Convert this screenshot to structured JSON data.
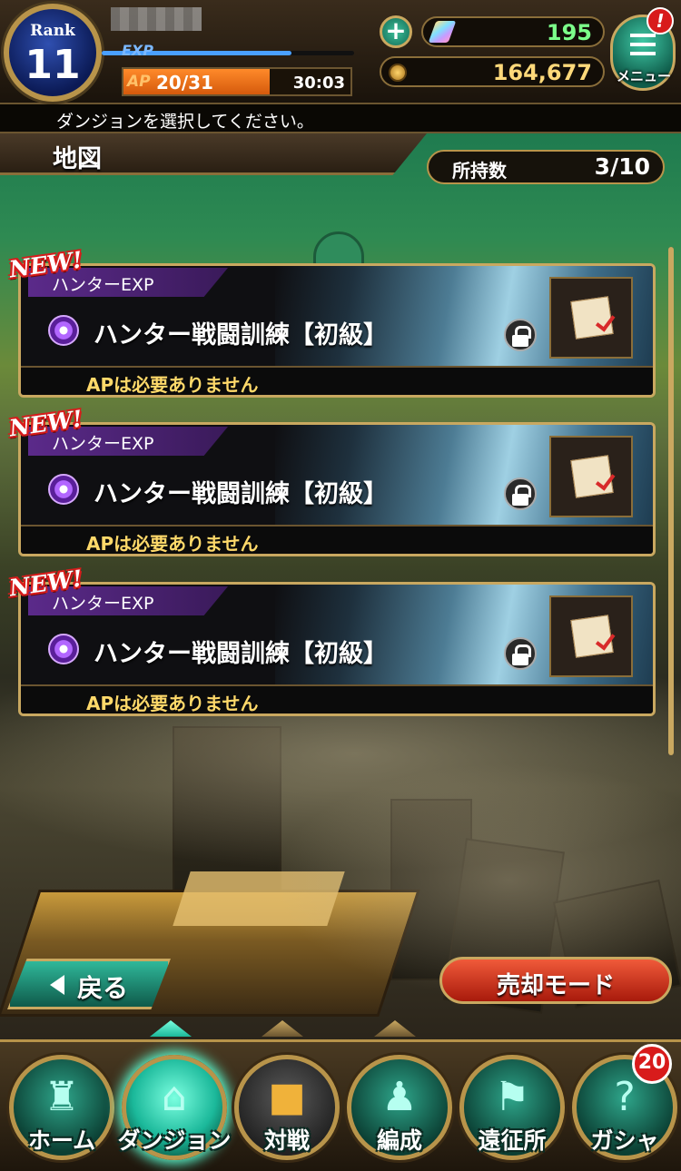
{
  "header": {
    "rank_label": "Rank",
    "rank_value": "11",
    "exp_label": "EXP",
    "exp_progress": 0.75,
    "ap_label": "AP",
    "ap_value": "20/31",
    "ap_progress": 0.645,
    "ap_timer": "30:03",
    "plus_symbol": "+",
    "gems": "195",
    "coins": "164,677",
    "menu_label": "メニュー",
    "menu_alert": "!"
  },
  "instruction": "ダンジョンを選択してください。",
  "title": "地図",
  "owned": {
    "label": "所持数",
    "value": "3/10"
  },
  "dungeons": [
    {
      "new_badge": "NEW!",
      "tag": "ハンターEXP",
      "name": "ハンター戦闘訓練【初級】",
      "ap_text": "APは必要ありません"
    },
    {
      "new_badge": "NEW!",
      "tag": "ハンターEXP",
      "name": "ハンター戦闘訓練【初級】",
      "ap_text": "APは必要ありません"
    },
    {
      "new_badge": "NEW!",
      "tag": "ハンターEXP",
      "name": "ハンター戦闘訓練【初級】",
      "ap_text": "APは必要ありません"
    }
  ],
  "buttons": {
    "back": "戻る",
    "sell_mode": "売却モード"
  },
  "tabs": [
    {
      "label": "ホーム",
      "icon": "home-castle-icon",
      "state": "normal"
    },
    {
      "label": "ダンジョン",
      "icon": "dungeon-gate-icon",
      "state": "active"
    },
    {
      "label": "対戦",
      "icon": "padlock-icon",
      "state": "locked"
    },
    {
      "label": "編成",
      "icon": "party-formation-icon",
      "state": "normal"
    },
    {
      "label": "遠征所",
      "icon": "flag-icon",
      "state": "normal"
    },
    {
      "label": "ガシャ",
      "icon": "gacha-question-icon",
      "state": "normal"
    }
  ],
  "gacha_badge": "20",
  "colors": {
    "accent_gold": "#c9a860",
    "teal": "#1bb89a",
    "gem_green": "#7cff8a",
    "coin_yellow": "#ffd97a",
    "alert_red": "#d81b1b"
  }
}
